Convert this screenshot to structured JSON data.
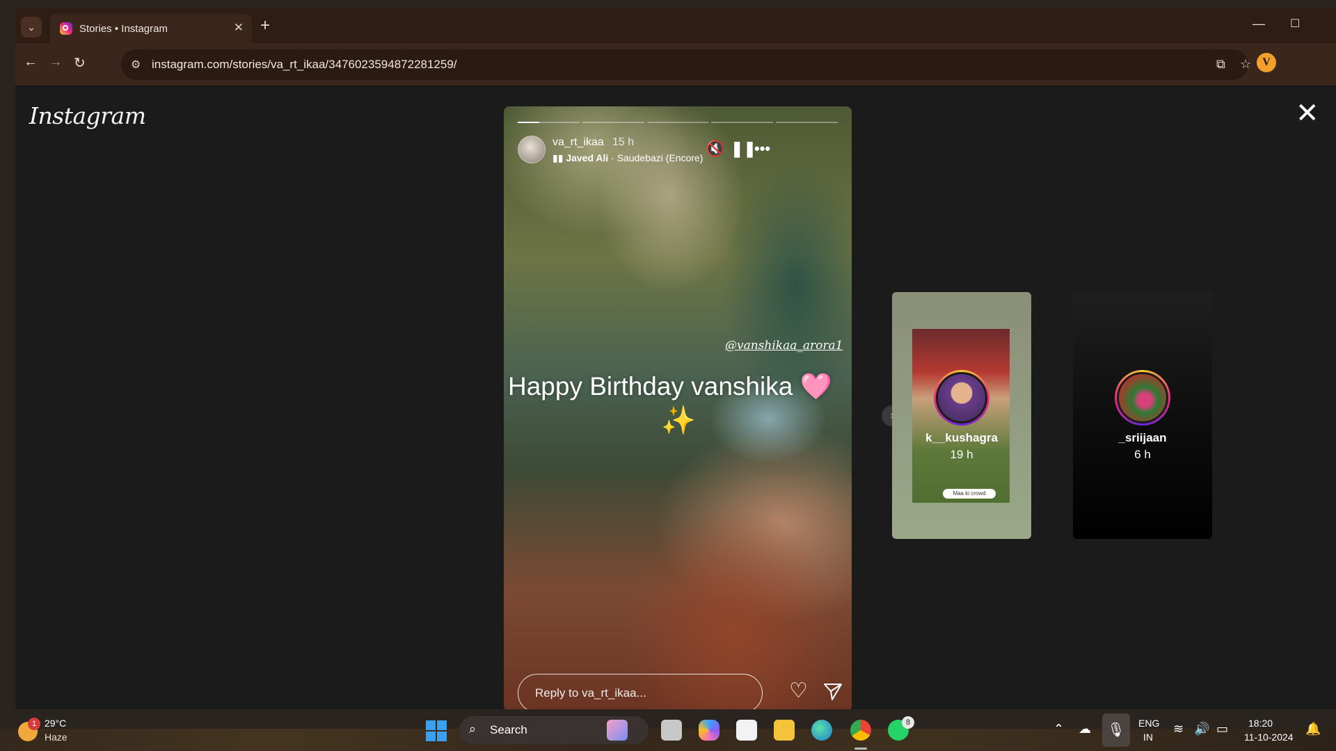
{
  "browser": {
    "tab_title": "Stories • Instagram",
    "tab_close": "✕",
    "new_tab": "+",
    "url": "instagram.com/stories/va_rt_ikaa/3476023594872281259/",
    "profile_initial": "V"
  },
  "instagram": {
    "logo": "Instagram",
    "close": "✕"
  },
  "story": {
    "username": "va_rt_ikaa",
    "time": "15 h",
    "music_artist": "Javed Ali",
    "music_track": " · Saudebazi (Encore)",
    "mention": "@vanshikaa_arora1",
    "caption": "Happy Birthday vanshika 🩷",
    "sparkle": "✨",
    "reply_placeholder": "Reply to va_rt_ikaa...",
    "progress_segments": 5,
    "current_segment": 1,
    "current_segment_progress": 0.35
  },
  "next_stories": [
    {
      "name": "k__kushagra",
      "age": "19 h",
      "thumb_label": "Maa ki crowd"
    },
    {
      "name": "_sriijaan",
      "age": "6 h"
    }
  ],
  "taskbar": {
    "weather_badge": "1",
    "temperature": "29°C",
    "condition": "Haze",
    "search": "Search",
    "whatsapp_badge": "8",
    "lang_line1": "ENG",
    "lang_line2": "IN",
    "time": "18:20",
    "date": "11-10-2024"
  }
}
